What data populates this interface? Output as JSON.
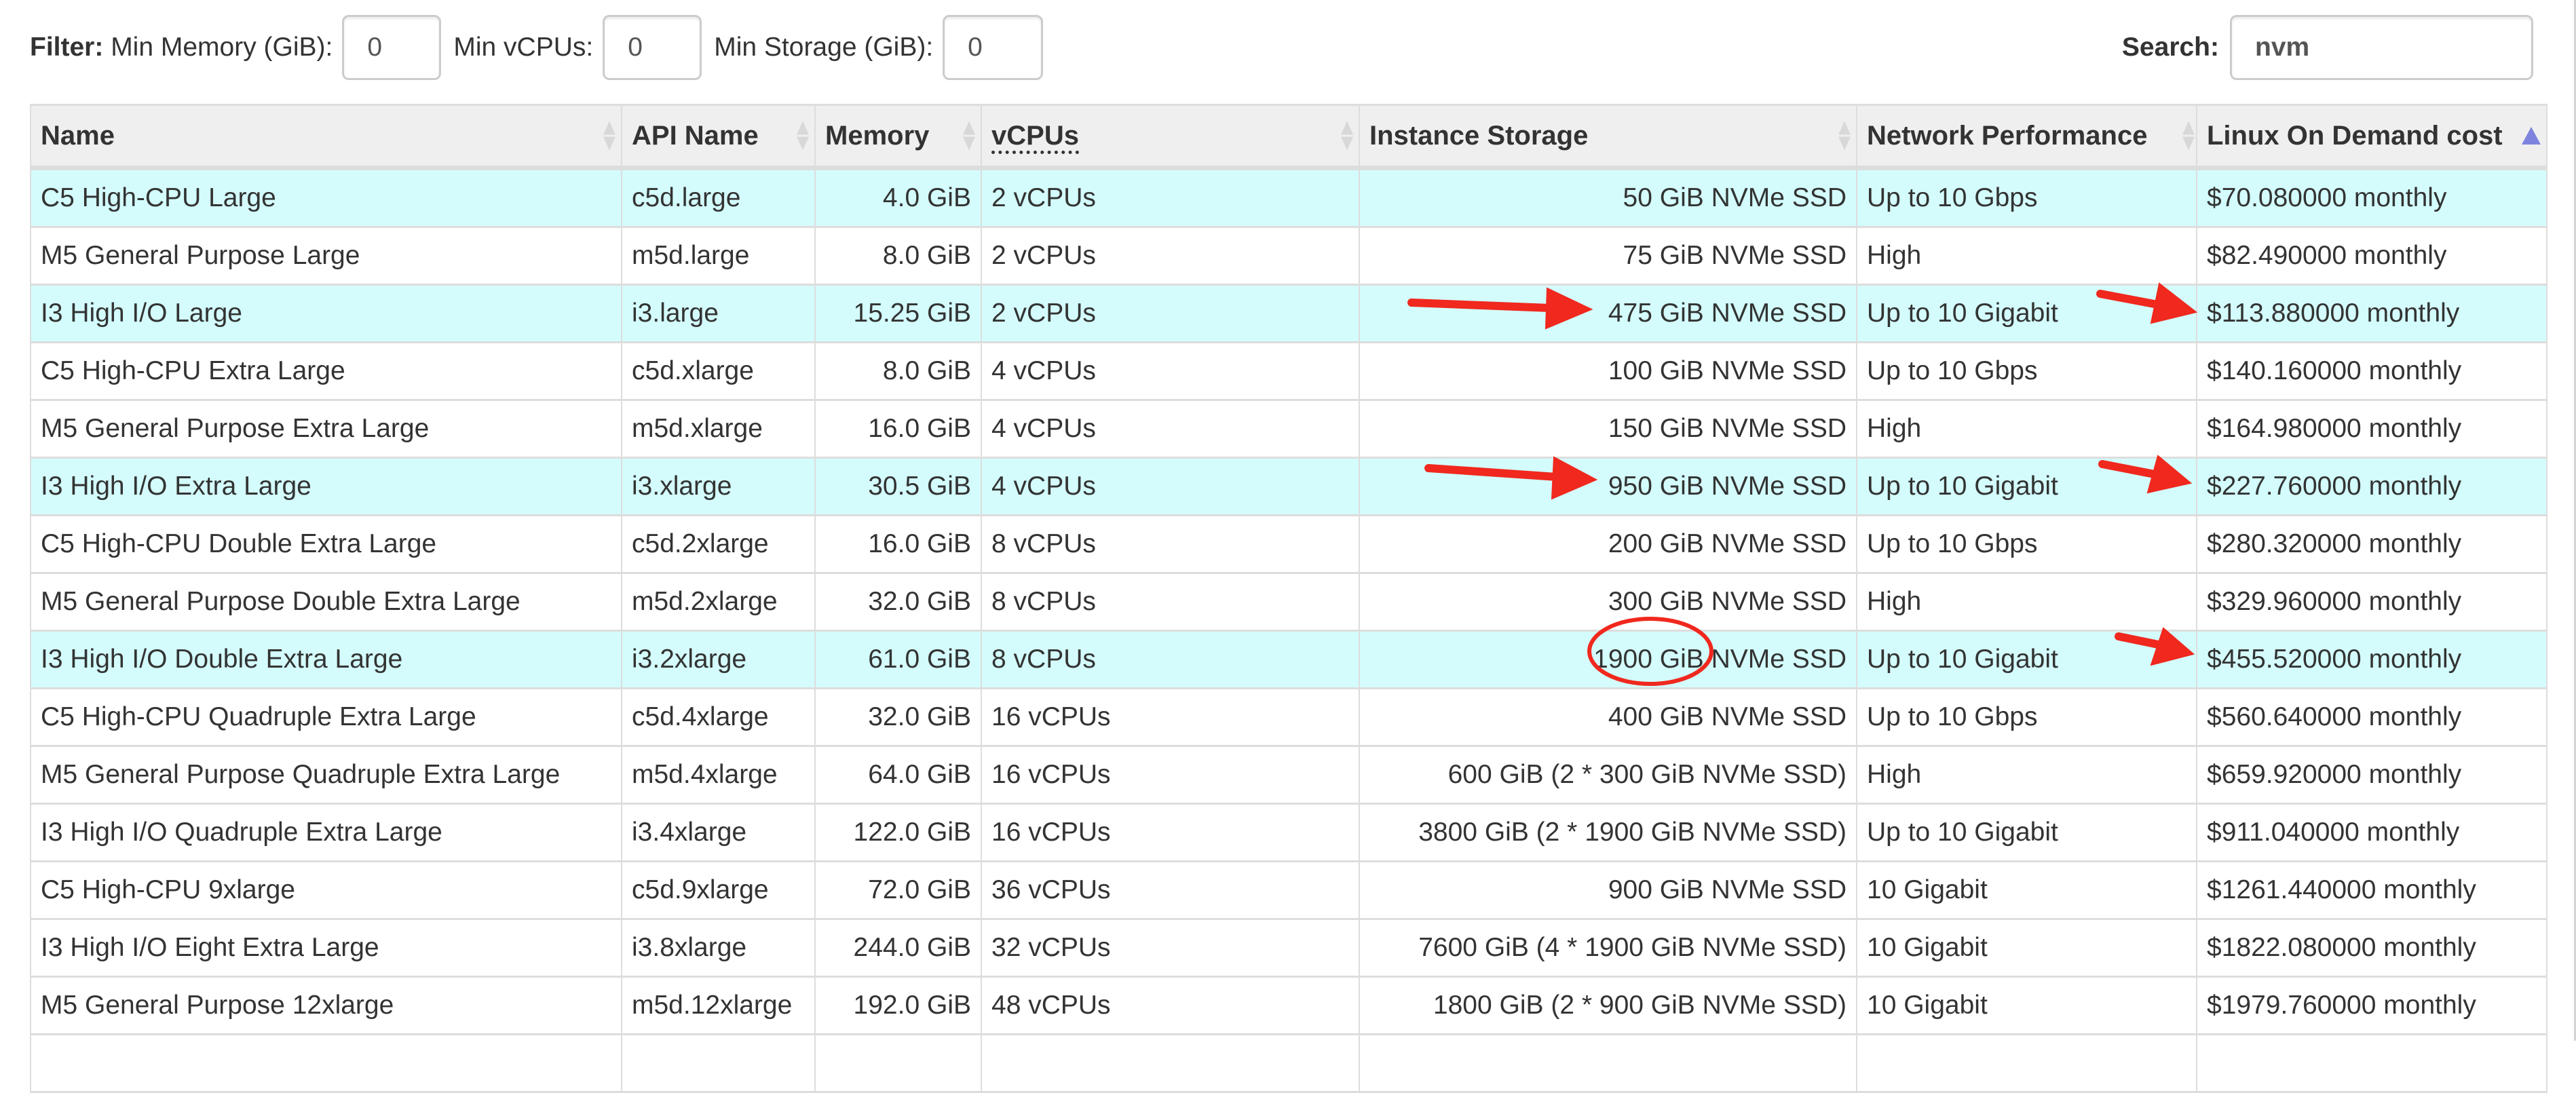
{
  "filter": {
    "label": "Filter:",
    "min_memory_label": "Min Memory (GiB):",
    "min_memory_value": "0",
    "min_vcpus_label": "Min vCPUs:",
    "min_vcpus_value": "0",
    "min_storage_label": "Min Storage (GiB):",
    "min_storage_value": "0"
  },
  "search": {
    "label": "Search:",
    "value": "nvm"
  },
  "table": {
    "columns": [
      {
        "label": "Name",
        "sort": "none"
      },
      {
        "label": "API Name",
        "sort": "none"
      },
      {
        "label": "Memory",
        "sort": "none"
      },
      {
        "label": "vCPUs",
        "sort": "none"
      },
      {
        "label": "Instance Storage",
        "sort": "none"
      },
      {
        "label": "Network Performance",
        "sort": "none"
      },
      {
        "label": "Linux On Demand cost",
        "sort": "ascending"
      }
    ],
    "highlight_color": "#d4fcfc",
    "rows": [
      {
        "name": "C5 High-CPU Large",
        "api": "c5d.large",
        "memory": "4.0 GiB",
        "vcpus": "2 vCPUs",
        "storage": "50 GiB NVMe SSD",
        "network": "Up to 10 Gbps",
        "cost": "$70.080000 monthly",
        "highlighted": true
      },
      {
        "name": "M5 General Purpose Large",
        "api": "m5d.large",
        "memory": "8.0 GiB",
        "vcpus": "2 vCPUs",
        "storage": "75 GiB NVMe SSD",
        "network": "High",
        "cost": "$82.490000 monthly",
        "highlighted": false
      },
      {
        "name": "I3 High I/O Large",
        "api": "i3.large",
        "memory": "15.25 GiB",
        "vcpus": "2 vCPUs",
        "storage": "475 GiB NVMe SSD",
        "network": "Up to 10 Gigabit",
        "cost": "$113.880000 monthly",
        "highlighted": true
      },
      {
        "name": "C5 High-CPU Extra Large",
        "api": "c5d.xlarge",
        "memory": "8.0 GiB",
        "vcpus": "4 vCPUs",
        "storage": "100 GiB NVMe SSD",
        "network": "Up to 10 Gbps",
        "cost": "$140.160000 monthly",
        "highlighted": false
      },
      {
        "name": "M5 General Purpose Extra Large",
        "api": "m5d.xlarge",
        "memory": "16.0 GiB",
        "vcpus": "4 vCPUs",
        "storage": "150 GiB NVMe SSD",
        "network": "High",
        "cost": "$164.980000 monthly",
        "highlighted": false
      },
      {
        "name": "I3 High I/O Extra Large",
        "api": "i3.xlarge",
        "memory": "30.5 GiB",
        "vcpus": "4 vCPUs",
        "storage": "950 GiB NVMe SSD",
        "network": "Up to 10 Gigabit",
        "cost": "$227.760000 monthly",
        "highlighted": true
      },
      {
        "name": "C5 High-CPU Double Extra Large",
        "api": "c5d.2xlarge",
        "memory": "16.0 GiB",
        "vcpus": "8 vCPUs",
        "storage": "200 GiB NVMe SSD",
        "network": "Up to 10 Gbps",
        "cost": "$280.320000 monthly",
        "highlighted": false
      },
      {
        "name": "M5 General Purpose Double Extra Large",
        "api": "m5d.2xlarge",
        "memory": "32.0 GiB",
        "vcpus": "8 vCPUs",
        "storage": "300 GiB NVMe SSD",
        "network": "High",
        "cost": "$329.960000 monthly",
        "highlighted": false
      },
      {
        "name": "I3 High I/O Double Extra Large",
        "api": "i3.2xlarge",
        "memory": "61.0 GiB",
        "vcpus": "8 vCPUs",
        "storage": "1900 GiB NVMe SSD",
        "network": "Up to 10 Gigabit",
        "cost": "$455.520000 monthly",
        "highlighted": true
      },
      {
        "name": "C5 High-CPU Quadruple Extra Large",
        "api": "c5d.4xlarge",
        "memory": "32.0 GiB",
        "vcpus": "16 vCPUs",
        "storage": "400 GiB NVMe SSD",
        "network": "Up to 10 Gbps",
        "cost": "$560.640000 monthly",
        "highlighted": false
      },
      {
        "name": "M5 General Purpose Quadruple Extra Large",
        "api": "m5d.4xlarge",
        "memory": "64.0 GiB",
        "vcpus": "16 vCPUs",
        "storage": "600 GiB (2 * 300 GiB NVMe SSD)",
        "network": "High",
        "cost": "$659.920000 monthly",
        "highlighted": false
      },
      {
        "name": "I3 High I/O Quadruple Extra Large",
        "api": "i3.4xlarge",
        "memory": "122.0 GiB",
        "vcpus": "16 vCPUs",
        "storage": "3800 GiB (2 * 1900 GiB NVMe SSD)",
        "network": "Up to 10 Gigabit",
        "cost": "$911.040000 monthly",
        "highlighted": false
      },
      {
        "name": "C5 High-CPU 9xlarge",
        "api": "c5d.9xlarge",
        "memory": "72.0 GiB",
        "vcpus": "36 vCPUs",
        "storage": "900 GiB NVMe SSD",
        "network": "10 Gigabit",
        "cost": "$1261.440000 monthly",
        "highlighted": false
      },
      {
        "name": "I3 High I/O Eight Extra Large",
        "api": "i3.8xlarge",
        "memory": "244.0 GiB",
        "vcpus": "32 vCPUs",
        "storage": "7600 GiB (4 * 1900 GiB NVMe SSD)",
        "network": "10 Gigabit",
        "cost": "$1822.080000 monthly",
        "highlighted": false
      },
      {
        "name": "M5 General Purpose 12xlarge",
        "api": "m5d.12xlarge",
        "memory": "192.0 GiB",
        "vcpus": "48 vCPUs",
        "storage": "1800 GiB (2 * 900 GiB NVMe SSD)",
        "network": "10 Gigabit",
        "cost": "$1979.760000 monthly",
        "highlighted": false
      },
      {
        "name": "",
        "api": "",
        "memory": "",
        "vcpus": "",
        "storage": "",
        "network": "",
        "cost": "",
        "highlighted": false
      }
    ]
  },
  "annotations": {
    "color": "#f0281e",
    "items": [
      {
        "type": "arrow",
        "target": "row-3-instance-storage"
      },
      {
        "type": "arrow",
        "target": "row-3-cost"
      },
      {
        "type": "arrow",
        "target": "row-6-instance-storage"
      },
      {
        "type": "arrow",
        "target": "row-6-cost"
      },
      {
        "type": "circle",
        "target": "row-9-instance-storage-1900-GiB"
      },
      {
        "type": "arrow",
        "target": "row-9-cost"
      }
    ]
  }
}
